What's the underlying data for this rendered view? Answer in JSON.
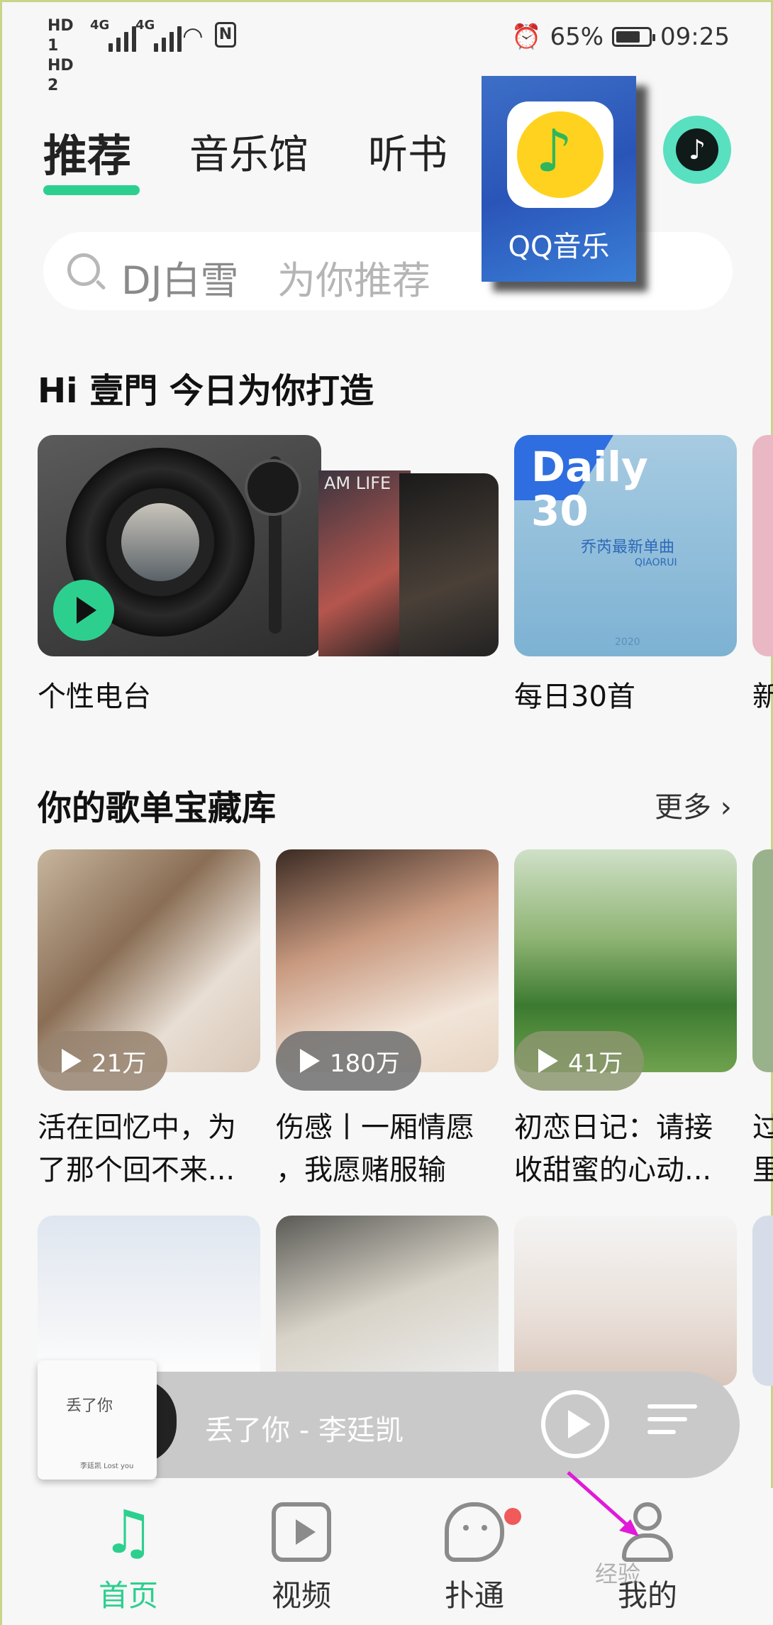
{
  "status_bar": {
    "hd1": "HD 1",
    "hd2": "HD 2",
    "net1": "4G",
    "net2": "4G",
    "battery": "65%",
    "time": "09:25"
  },
  "tabs": [
    {
      "label": "推荐",
      "active": true
    },
    {
      "label": "音乐馆",
      "active": false
    },
    {
      "label": "听书",
      "active": false
    }
  ],
  "app_overlay": {
    "name": "QQ音乐"
  },
  "search": {
    "placeholder_main": "DJ白雪",
    "placeholder_hint": "为你推荐"
  },
  "greeting": {
    "title": "Hi 壹門  今日为你打造"
  },
  "daily_cards": [
    {
      "label": "个性电台"
    },
    {
      "label": "每日30首",
      "cover_line1": "Daily",
      "cover_line2": "30",
      "cover_caption": "乔芮最新单曲",
      "cover_sub": "QIAORUI",
      "cover_year": "2020"
    },
    {
      "label": "新"
    }
  ],
  "album_text": "AM LIFE",
  "playlists_section": {
    "title": "你的歌单宝藏库",
    "more": "更多"
  },
  "playlists": [
    {
      "count": "21万",
      "line1": "活在回忆中，为",
      "line2": "了那个回不来..."
    },
    {
      "count": "180万",
      "line1": "伤感丨一厢情愿",
      "line2": "，我愿赌服输"
    },
    {
      "count": "41万",
      "line1": "初恋日记：请接",
      "line2": "收甜蜜的心动..."
    },
    {
      "line1": "过",
      "line2": "里"
    }
  ],
  "mini_player": {
    "track": "丢了你 - 李廷凯",
    "cover_text": "丢了你",
    "cover_sub": "李廷凯 Lost you"
  },
  "bottom_nav": [
    {
      "label": "首页",
      "active": true
    },
    {
      "label": "视频",
      "active": false
    },
    {
      "label": "扑通",
      "active": false,
      "badge": true
    },
    {
      "label": "我的",
      "active": false
    }
  ],
  "watermark": "经验",
  "colors": {
    "accent": "#2dcf8f",
    "badge": "#f05a5a",
    "annotation_arrow": "#e01ad8"
  }
}
